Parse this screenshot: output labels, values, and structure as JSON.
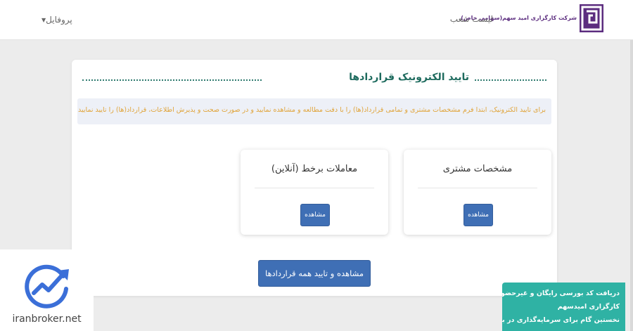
{
  "navbar": {
    "company_name": "شرکت کارگزاری امید سهم(سهامی خاص)",
    "branches_link": "لیست شعب",
    "profile_link": "پروفایل"
  },
  "main": {
    "section_title": "تایید الکترونیک قراردادها",
    "notice": "برای تایید الکترونیک، ابتدا فرم مشخصات مشتری و تمامی قرارداد(ها) را با دقت مطالعه و مشاهده نمایید و در صورت صحت و پذیرش اطلاعات، قرارداد(ها) را تایید نمایید.",
    "cards": [
      {
        "title": "مشخصات مشتری",
        "button": "مشاهده"
      },
      {
        "title": "معاملات برخط (آنلاین)",
        "button": "مشاهده"
      }
    ],
    "view_all_button": "مشاهده و تایید همه قراردادها"
  },
  "overlay": {
    "brand": "iranbroker.net",
    "promo_lines": [
      "دریافت کد بورسی رایگان و غیرحضوری |",
      "کارگزاری امیدسهم",
      "نخستین گام برای سرمایه‌گذاری در بورس"
    ]
  },
  "colors": {
    "primary_button": "#3f6fb5",
    "title_green": "#1e6b5e",
    "notice_text": "#e0a43a",
    "notice_bg": "#edf0f7",
    "promo_bg": "#2fb2a4",
    "logo_purple": "#5c2d7f"
  },
  "icons": {
    "logo": "omid-sahm-logo",
    "overlay": "trend-chart-icon",
    "caret": "caret-down-icon"
  }
}
